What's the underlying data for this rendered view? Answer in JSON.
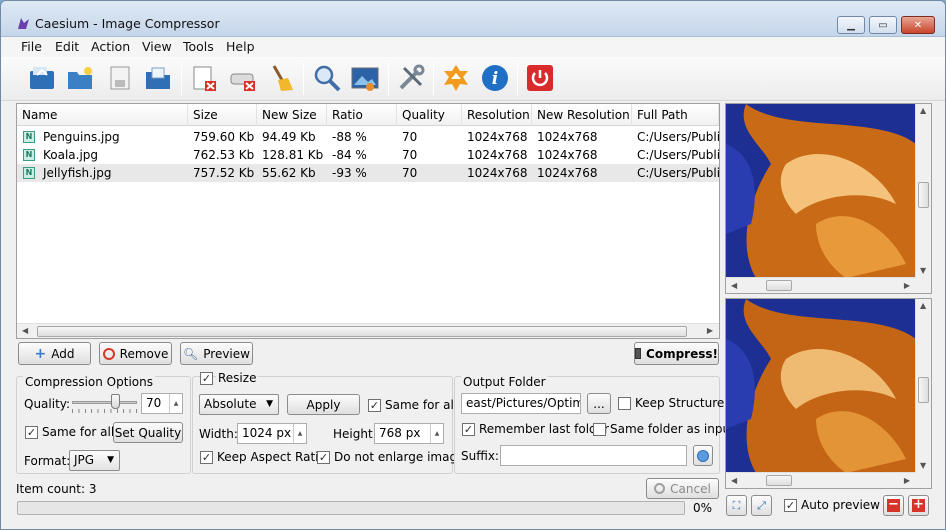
{
  "window": {
    "title": "Caesium - Image Compressor"
  },
  "menu": [
    "File",
    "Edit",
    "Action",
    "View",
    "Tools",
    "Help"
  ],
  "toolbar_icons": [
    "open-files-icon",
    "open-folder-icon",
    "save-icon",
    "export-icon",
    "remove-item-icon",
    "clear-list-icon",
    "broom-icon",
    "search-icon",
    "compare-image-icon",
    "settings-tools-icon",
    "update-icon",
    "info-icon",
    "power-icon"
  ],
  "table": {
    "columns": [
      "Name",
      "Size",
      "New Size",
      "Ratio",
      "Quality",
      "Resolution",
      "New Resolution",
      "Full Path"
    ],
    "rows": [
      {
        "name": "Penguins.jpg",
        "size": "759.60 Kb",
        "new_size": "94.49 Kb",
        "ratio": "-88 %",
        "quality": "70",
        "resolution": "1024x768",
        "new_resolution": "1024x768",
        "path": "C:/Users/Public"
      },
      {
        "name": "Koala.jpg",
        "size": "762.53 Kb",
        "new_size": "128.81 Kb",
        "ratio": "-84 %",
        "quality": "70",
        "resolution": "1024x768",
        "new_resolution": "1024x768",
        "path": "C:/Users/Public"
      },
      {
        "name": "Jellyfish.jpg",
        "size": "757.52 Kb",
        "new_size": "55.62 Kb",
        "ratio": "-93 %",
        "quality": "70",
        "resolution": "1024x768",
        "new_resolution": "1024x768",
        "path": "C:/Users/Public"
      }
    ]
  },
  "buttons": {
    "add": "Add",
    "remove": "Remove",
    "preview": "Preview",
    "compress": "Compress!",
    "apply": "Apply",
    "set_quality": "Set Quality",
    "cancel": "Cancel",
    "browse": "..."
  },
  "compression": {
    "title": "Compression Options",
    "quality_label": "Quality:",
    "quality_value": "70",
    "quality_fraction": 0.7,
    "same_for_all": "Same for all",
    "format_label": "Format:",
    "format_value": "JPG"
  },
  "resize": {
    "title": "Resize",
    "mode": "Absolute",
    "same_for_all": "Same for all",
    "width_label": "Width:",
    "width_value": "1024 px",
    "height_label": "Height:",
    "height_value": "768 px",
    "keep_aspect": "Keep Aspect Ratio",
    "no_enlarge": "Do not enlarge images"
  },
  "output": {
    "title": "Output Folder",
    "path": "east/Pictures/Optimised",
    "keep_structure": "Keep Structure",
    "remember": "Remember last folder",
    "same_folder": "Same folder as input",
    "suffix_label": "Suffix:",
    "suffix_value": ""
  },
  "status": {
    "item_count": "Item count: 3",
    "progress_text": "0%",
    "progress": 0
  },
  "preview": {
    "auto_preview": "Auto preview"
  }
}
